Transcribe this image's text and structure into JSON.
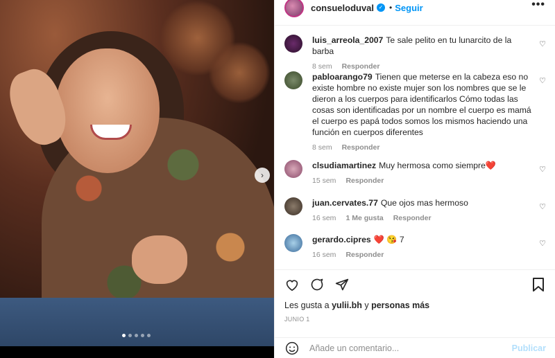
{
  "post": {
    "username": "consueloduval",
    "separator": "•",
    "follow_label": "Seguir",
    "more_label": "•••",
    "carousel": {
      "total": 5,
      "active": 0,
      "next_icon": "chevron-right-icon"
    }
  },
  "comments": [
    {
      "user": "luis_arreola_2007",
      "text": "Te sale pelito en tu lunarcito de la barba",
      "time": "8 sem",
      "reply": "Responder",
      "likes": ""
    },
    {
      "user": "pabloarango79",
      "text": "Tienen que meterse en la cabeza eso no existe hombre no existe mujer son los nombres que se le dieron a los cuerpos para identificarlos Cómo todas las cosas son identificadas por un nombre el cuerpo es mamá el cuerpo es papá todos somos los mismos haciendo una función en cuerpos diferentes",
      "time": "8 sem",
      "reply": "Responder",
      "likes": ""
    },
    {
      "user": "clsudiamartinez",
      "text": "Muy hermosa como siempre",
      "emoji": "❤️",
      "time": "15 sem",
      "reply": "Responder",
      "likes": ""
    },
    {
      "user": "juan.cervates.77",
      "text": "Que ojos mas hermoso",
      "time": "16 sem",
      "reply": "Responder",
      "likes": "1 Me gusta"
    },
    {
      "user": "gerardo.cipres",
      "text": "7",
      "emoji": "❤️ 😘",
      "time": "16 sem",
      "reply": "Responder",
      "likes": ""
    }
  ],
  "actions": {
    "likes_prefix": "Les gusta a ",
    "likes_user": "yulii.bh",
    "likes_conj": " y ",
    "likes_rest": "personas más",
    "date": "JUNIO 1",
    "comment_placeholder": "Añade un comentario...",
    "publish_label": "Publicar"
  },
  "colors": {
    "accent": "#0095f6",
    "heart": "#ed4956",
    "muted": "#8e8e8e"
  }
}
